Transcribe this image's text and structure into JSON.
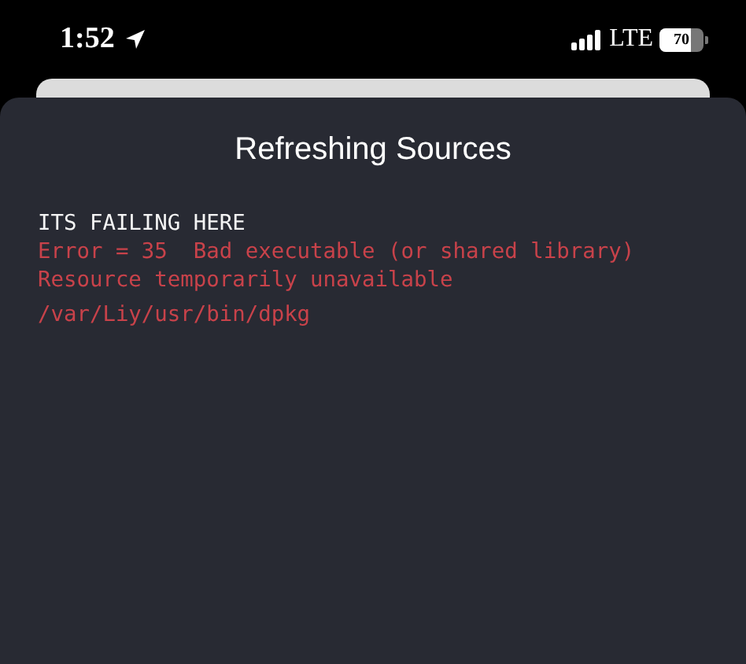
{
  "status_bar": {
    "time": "1:52",
    "network": "LTE",
    "battery": {
      "level": 0.7,
      "reading": "70"
    }
  },
  "sheet": {
    "title": "Refreshing Sources",
    "log": [
      {
        "kind": "normal",
        "text": "ITS FAILING HERE"
      },
      {
        "kind": "error",
        "text": "Error = 35  Bad executable (or shared library)"
      },
      {
        "kind": "error",
        "text": "Resource temporarily unavailable"
      },
      {
        "kind": "error",
        "text": "/var/Liy/usr/bin/dpkg"
      }
    ]
  }
}
